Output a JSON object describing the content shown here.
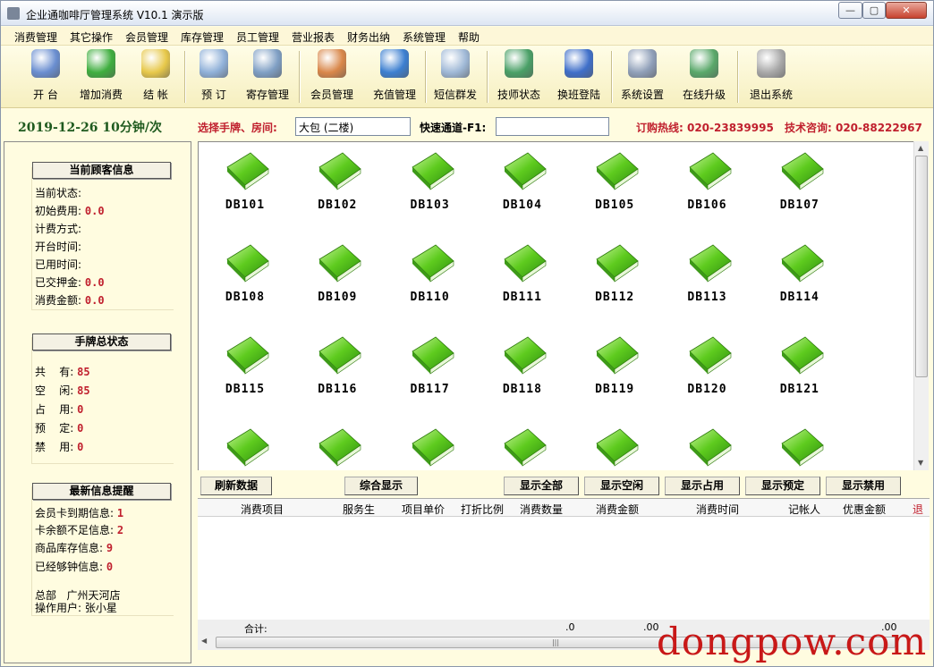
{
  "window": {
    "title": "企业通咖啡厅管理系统 V10.1 演示版",
    "min": "—",
    "max": "▢",
    "close": "✕"
  },
  "menu": [
    "消费管理",
    "其它操作",
    "会员管理",
    "库存管理",
    "员工管理",
    "营业报表",
    "财务出纳",
    "系统管理",
    "帮助"
  ],
  "toolbar": [
    {
      "label": "开  台",
      "icon": "open-table-icon",
      "color": "#6a8ed0"
    },
    {
      "label": "增加消费",
      "icon": "add-consumption-icon",
      "color": "#3fae3f"
    },
    {
      "label": "结  帐",
      "icon": "checkout-icon",
      "color": "#e7c84a"
    },
    {
      "label": "预  订",
      "icon": "reservation-icon",
      "color": "#8fb0d8"
    },
    {
      "label": "寄存管理",
      "icon": "storage-icon",
      "color": "#7f9fc4"
    },
    {
      "label": "会员管理",
      "icon": "member-icon",
      "color": "#d9874a"
    },
    {
      "label": "充值管理",
      "icon": "recharge-icon",
      "color": "#3c7fd0"
    },
    {
      "label": "短信群发",
      "icon": "sms-icon",
      "color": "#9fb8d6"
    },
    {
      "label": "技师状态",
      "icon": "technician-icon",
      "color": "#4aa067"
    },
    {
      "label": "换班登陆",
      "icon": "shift-login-icon",
      "color": "#3f6fc9"
    },
    {
      "label": "系统设置",
      "icon": "settings-icon",
      "color": "#8f9fb8"
    },
    {
      "label": "在线升级",
      "icon": "upgrade-icon",
      "color": "#5aa86a"
    },
    {
      "label": "退出系统",
      "icon": "exit-icon",
      "color": "#a8a8a8"
    }
  ],
  "status": {
    "date": "2019-12-26  10分钟/次",
    "select_label": "选择手牌、房间:",
    "room_value": "大包 (二楼)",
    "quick_label": "快速通道-F1:",
    "quick_value": "",
    "hotline": "订购热线: 020-23839995",
    "support": "技术咨询: 020-88222967"
  },
  "customer": {
    "title": "当前顾客信息",
    "rows": [
      {
        "label": "当前状态:",
        "value": ""
      },
      {
        "label": "初始费用:",
        "value": "0.0"
      },
      {
        "label": "计费方式:",
        "value": ""
      },
      {
        "label": "开台时间:",
        "value": ""
      },
      {
        "label": "已用时间:",
        "value": ""
      },
      {
        "label": "已交押金:",
        "value": "0.0"
      },
      {
        "label": "消费金额:",
        "value": "0.0"
      }
    ]
  },
  "summary": {
    "title": "手牌总状态",
    "rows": [
      {
        "label": "共    有:",
        "value": "85"
      },
      {
        "label": "空    闲:",
        "value": "85"
      },
      {
        "label": "占    用:",
        "value": "0"
      },
      {
        "label": "预    定:",
        "value": "0"
      },
      {
        "label": "禁    用:",
        "value": "0"
      }
    ]
  },
  "alerts": {
    "title": "最新信息提醒",
    "rows": [
      {
        "label": "会员卡到期信息:",
        "value": "1"
      },
      {
        "label": "卡余额不足信息:",
        "value": "2"
      },
      {
        "label": "商品库存信息:",
        "value": "9"
      },
      {
        "label": "已经够钟信息:",
        "value": "0"
      }
    ]
  },
  "footer": {
    "branch": "总部   广州天河店",
    "user": "操作用户: 张小星"
  },
  "rooms": [
    "DB101",
    "DB102",
    "DB103",
    "DB104",
    "DB105",
    "DB106",
    "DB107",
    "DB108",
    "DB109",
    "DB110",
    "DB111",
    "DB112",
    "DB113",
    "DB114",
    "DB115",
    "DB116",
    "DB117",
    "DB118",
    "DB119",
    "DB120",
    "DB121",
    "",
    "",
    "",
    "",
    "",
    "",
    ""
  ],
  "room_status_color": "#5ecb1e",
  "buttons": {
    "refresh": "刷新数据",
    "combined": "综合显示",
    "all": "显示全部",
    "free": "显示空闲",
    "used": "显示占用",
    "reserved": "显示预定",
    "disabled": "显示禁用"
  },
  "table": {
    "columns": [
      "消费项目",
      "服务生",
      "项目单价",
      "打折比例",
      "消费数量",
      "消费金额",
      "消费时间",
      "记帐人",
      "优惠金额",
      "退"
    ],
    "footer": {
      "label": "合计:",
      "qty": ".0",
      "amount": ".00",
      "discount": ".00"
    }
  },
  "watermark": "dongpow.com"
}
